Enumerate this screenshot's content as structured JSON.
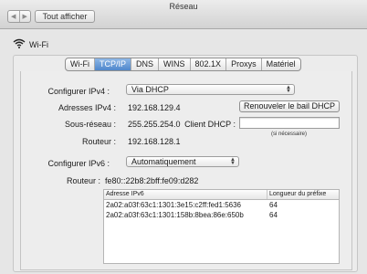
{
  "window": {
    "title": "Réseau"
  },
  "toolbar": {
    "back_icon": "chevron-left-icon",
    "forward_icon": "chevron-right-icon",
    "show_all_label": "Tout afficher"
  },
  "service": {
    "name": "Wi-Fi",
    "icon": "wifi-icon"
  },
  "tabs": [
    {
      "label": "Wi-Fi",
      "active": false
    },
    {
      "label": "TCP/IP",
      "active": true
    },
    {
      "label": "DNS",
      "active": false
    },
    {
      "label": "WINS",
      "active": false
    },
    {
      "label": "802.1X",
      "active": false
    },
    {
      "label": "Proxys",
      "active": false
    },
    {
      "label": "Matériel",
      "active": false
    }
  ],
  "ipv4": {
    "configure_label": "Configurer IPv4 :",
    "configure_value": "Via DHCP",
    "address_label": "Adresses IPv4 :",
    "address_value": "192.168.129.4",
    "subnet_label": "Sous-réseau :",
    "subnet_value": "255.255.254.0",
    "router_label": "Routeur :",
    "router_value": "192.168.128.1",
    "renew_button": "Renouveler le bail DHCP",
    "client_label": "Client DHCP :",
    "client_value": "",
    "client_note": "(si nécessaire)"
  },
  "ipv6": {
    "configure_label": "Configurer IPv6 :",
    "configure_value": "Automatiquement",
    "router_label": "Routeur :",
    "router_value": "fe80::22b8:2bff:fe09:d282",
    "table_headers": [
      "Adresse IPv6",
      "Longueur du préfixe"
    ],
    "rows": [
      [
        "2a02:a03f:63c1:1301:3e15:c2ff:fed1:5636",
        "64"
      ],
      [
        "2a02:a03f:63c1:1301:158b:8bea:86e:650b",
        "64"
      ]
    ]
  },
  "colors": {
    "accent": "#4f87cc"
  }
}
